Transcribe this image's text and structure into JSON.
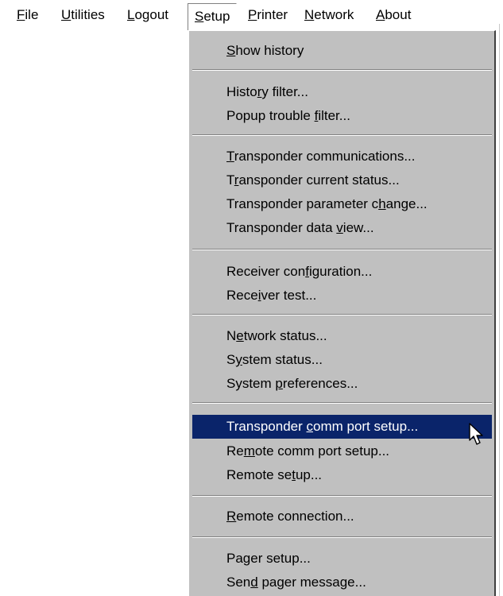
{
  "menubar": {
    "items": [
      {
        "label": "File",
        "mnemonic": 0
      },
      {
        "label": "Utilities",
        "mnemonic": 0
      },
      {
        "label": "Logout",
        "mnemonic": 0
      },
      {
        "label": "Setup",
        "mnemonic": 0
      },
      {
        "label": "Printer",
        "mnemonic": 0
      },
      {
        "label": "Network",
        "mnemonic": 0
      },
      {
        "label": "About",
        "mnemonic": 0
      }
    ]
  },
  "setup_menu": {
    "items": [
      {
        "label": "Show history",
        "mnemonic": 0
      },
      {
        "label": "History filter...",
        "mnemonic": 5
      },
      {
        "label": "Popup trouble filter...",
        "mnemonic": 14
      },
      {
        "label": "Transponder communications...",
        "mnemonic": 0
      },
      {
        "label": "Transponder current status...",
        "mnemonic": 1
      },
      {
        "label": "Transponder parameter change...",
        "mnemonic": 23
      },
      {
        "label": "Transponder data view...",
        "mnemonic": 17
      },
      {
        "label": "Receiver configuration...",
        "mnemonic": 12
      },
      {
        "label": "Receiver test...",
        "mnemonic": 4
      },
      {
        "label": "Network status...",
        "mnemonic": 1
      },
      {
        "label": "System status...",
        "mnemonic": 1
      },
      {
        "label": "System preferences...",
        "mnemonic": 7
      },
      {
        "label": "Transponder comm port setup...",
        "mnemonic": 12,
        "highlighted": true
      },
      {
        "label": "Remote comm port setup...",
        "mnemonic": 2
      },
      {
        "label": "Remote setup...",
        "mnemonic": 9
      },
      {
        "label": "Remote connection...",
        "mnemonic": 0
      },
      {
        "label": "Pager setup...",
        "mnemonic": 2
      },
      {
        "label": "Send pager message...",
        "mnemonic": 3
      }
    ]
  },
  "colors": {
    "menu_background": "#c0c0c0",
    "highlight_background": "#0a246a",
    "highlight_text": "#ffffff"
  },
  "icons": {
    "cursor": "mouse-pointer-icon"
  }
}
